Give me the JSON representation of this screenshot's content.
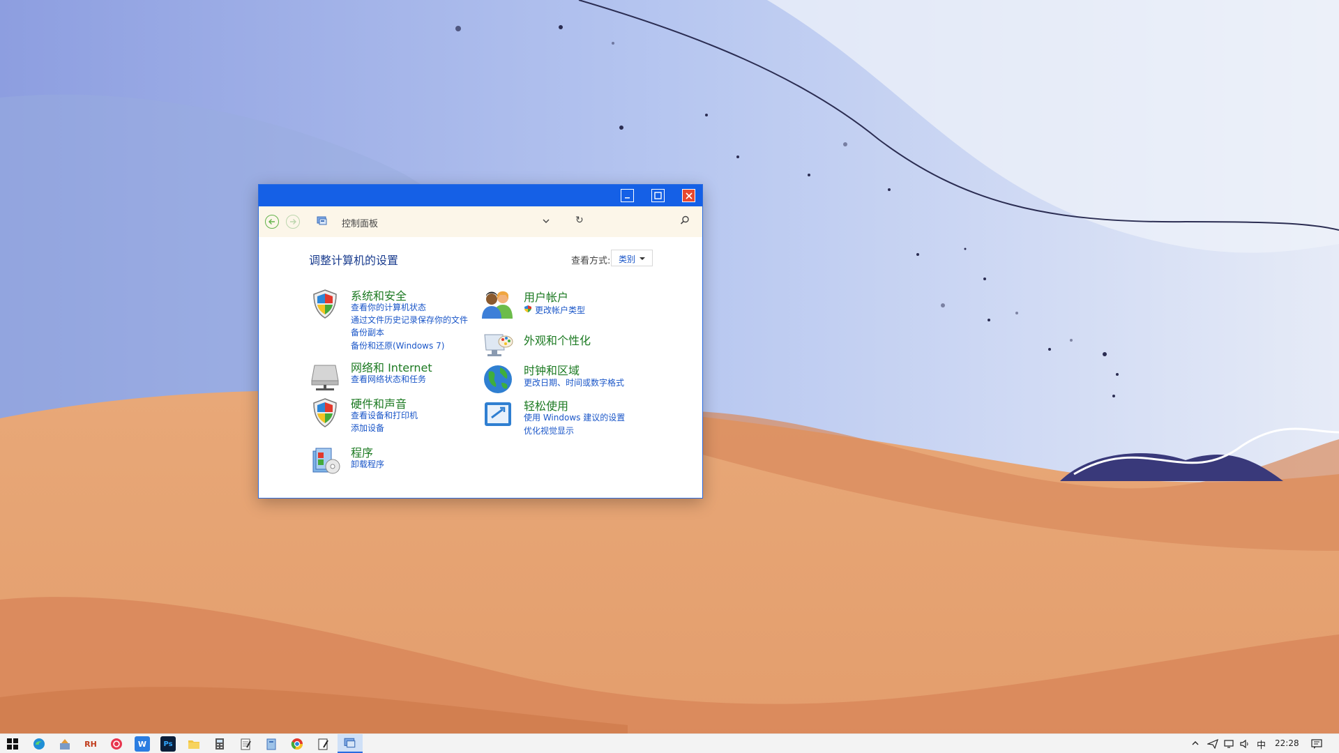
{
  "window": {
    "address": "控制面板",
    "heading": "调整计算机的设置",
    "view_by_label": "查看方式:",
    "view_by_value": "类别"
  },
  "categories": [
    {
      "title": "系统和安全",
      "links": [
        "查看你的计算机状态",
        "通过文件历史记录保存你的文件备份副本",
        "备份和还原(Windows 7)"
      ]
    },
    {
      "title": "网络和 Internet",
      "links": [
        "查看网络状态和任务"
      ]
    },
    {
      "title": "硬件和声音",
      "links": [
        "查看设备和打印机",
        "添加设备"
      ]
    },
    {
      "title": "程序",
      "links": [
        "卸载程序"
      ]
    },
    {
      "title": "用户帐户",
      "links": [
        "更改帐户类型"
      ]
    },
    {
      "title": "外观和个性化",
      "links": []
    },
    {
      "title": "时钟和区域",
      "links": [
        "更改日期、时间或数字格式"
      ]
    },
    {
      "title": "轻松使用",
      "links": [
        "使用 Windows 建议的设置",
        "优化视觉显示"
      ]
    }
  ],
  "taskbar": {
    "clock": "22:28",
    "ime": "中",
    "apps": [
      "start-icon",
      "edge-icon",
      "app-icon",
      "rh-icon",
      "netease-icon",
      "wps-icon",
      "photoshop-icon",
      "explorer-icon",
      "calculator-icon",
      "notepad-icon",
      "files-icon",
      "chrome-icon",
      "editor-icon",
      "control-panel-icon"
    ],
    "rh_label": "RH",
    "ps_label": "Ps",
    "wps_label": "W"
  },
  "colors": {
    "titlebar": "#1560e6",
    "category_title": "#1c7a22",
    "link": "#1a56c8",
    "heading": "#1a3c8e"
  }
}
